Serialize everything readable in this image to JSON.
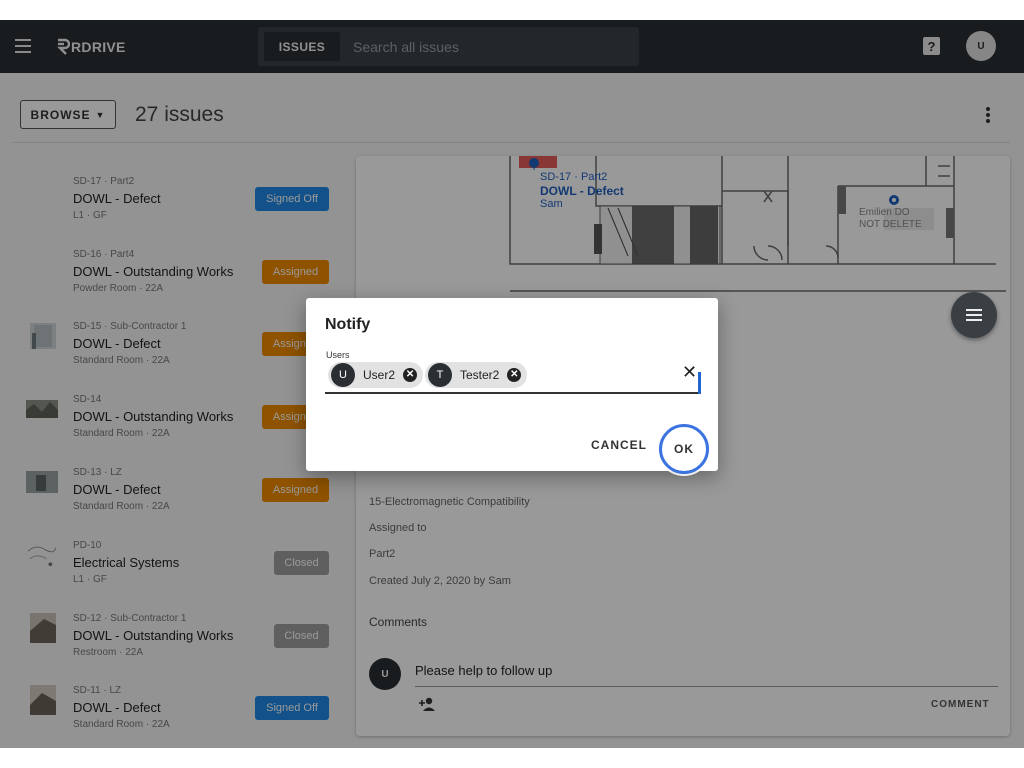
{
  "topbar": {
    "logo_text": "RDRIVE",
    "issues_tab_label": "ISSUES",
    "search_placeholder": "Search all issues",
    "help_icon": "help-box-icon",
    "avatar_initial": "U"
  },
  "toolbar": {
    "browse_label": "BROWSE",
    "issue_count": "27 issues"
  },
  "issues": [
    {
      "subtitle": "SD-17 · Part2",
      "title": "DOWL - Defect",
      "location": "L1 · GF",
      "status": "Signed Off",
      "status_type": "signed",
      "has_thumb": false
    },
    {
      "subtitle": "SD-16 · Part4",
      "title": "DOWL - Outstanding Works",
      "location": "Powder Room · 22A",
      "status": "Assigned",
      "status_type": "assigned",
      "has_thumb": false
    },
    {
      "subtitle": "SD-15 · Sub-Contractor 1",
      "title": "DOWL - Defect",
      "location": "Standard Room · 22A",
      "status": "Assigned",
      "status_type": "assigned",
      "has_thumb": true
    },
    {
      "subtitle": "SD-14",
      "title": "DOWL - Outstanding Works",
      "location": "Standard Room · 22A",
      "status": "Assigned",
      "status_type": "assigned",
      "has_thumb": true
    },
    {
      "subtitle": "SD-13 · LZ",
      "title": "DOWL - Defect",
      "location": "Standard Room · 22A",
      "status": "Assigned",
      "status_type": "assigned",
      "has_thumb": true
    },
    {
      "subtitle": "PD-10",
      "title": "Electrical Systems",
      "location": "L1 · GF",
      "status": "Closed",
      "status_type": "closed",
      "has_thumb": true
    },
    {
      "subtitle": "SD-12 · Sub-Contractor 1",
      "title": "DOWL - Outstanding Works",
      "location": "Restroom · 22A",
      "status": "Closed",
      "status_type": "closed",
      "has_thumb": true
    },
    {
      "subtitle": "SD-11 · LZ",
      "title": "DOWL - Defect",
      "location": "Standard Room · 22A",
      "status": "Signed Off",
      "status_type": "signed",
      "has_thumb": true
    }
  ],
  "detail": {
    "plan_label_line1": "SD-17 · Part2",
    "plan_label_line2": "DOWL - Defect",
    "plan_label_line3": "Sam",
    "plan_right_line1": "Emilien DO",
    "plan_right_line2": "NOT DELETE",
    "category": "15-Electromagnetic Compatibility",
    "assigned_to_label": "Assigned to",
    "assigned_to": "Part2",
    "created": "Created July 2, 2020 by Sam",
    "comments_label": "Comments",
    "comment_avatar": "U",
    "comment_text": "Please help to follow up",
    "comment_button": "COMMENT"
  },
  "dialog": {
    "title": "Notify",
    "users_label": "Users",
    "chips": [
      {
        "initial": "U",
        "name": "User2"
      },
      {
        "initial": "T",
        "name": "Tester2"
      }
    ],
    "clear_symbol": "✕",
    "cancel_label": "CANCEL",
    "ok_label": "OK"
  },
  "colors": {
    "topbar": "#2b2f33",
    "signed": "#1e88e5",
    "assigned": "#ef8a00",
    "closed": "#9e9e9e",
    "focus_ring": "#3b74e0"
  }
}
